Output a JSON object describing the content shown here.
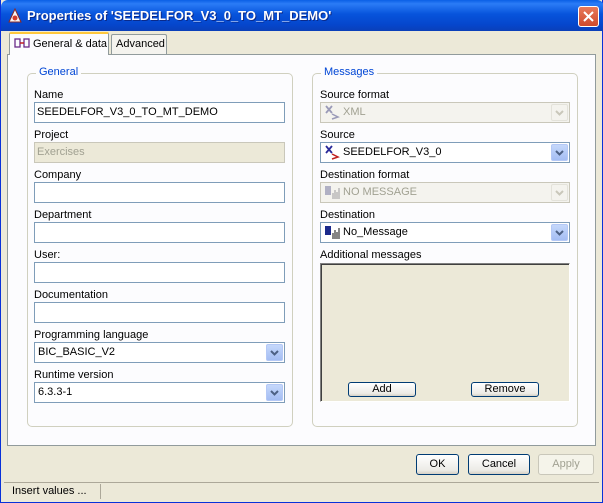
{
  "window": {
    "title": "Properties of 'SEEDELFOR_V3_0_TO_MT_DEMO'"
  },
  "tabs": [
    {
      "label": "General & data",
      "active": true
    },
    {
      "label": "Advanced",
      "active": false
    }
  ],
  "general": {
    "title": "General",
    "name": {
      "label": "Name",
      "value": "SEEDELFOR_V3_0_TO_MT_DEMO"
    },
    "project": {
      "label": "Project",
      "value": "Exercises",
      "disabled": true
    },
    "company": {
      "label": "Company",
      "value": ""
    },
    "department": {
      "label": "Department",
      "value": ""
    },
    "user": {
      "label": "User:",
      "value": ""
    },
    "documentation": {
      "label": "Documentation",
      "value": ""
    },
    "programming_language": {
      "label": "Programming language",
      "value": "BIC_BASIC_V2"
    },
    "runtime_version": {
      "label": "Runtime version",
      "value": "6.3.3-1"
    }
  },
  "messages": {
    "title": "Messages",
    "source_format": {
      "label": "Source format",
      "value": "XML",
      "icon": "xml-format-icon",
      "disabled": true
    },
    "source": {
      "label": "Source",
      "value": "SEEDELFOR_V3_0",
      "icon": "xml-format-icon"
    },
    "destination_format": {
      "label": "Destination format",
      "value": "NO MESSAGE",
      "icon": "data-format-icon",
      "disabled": true
    },
    "destination": {
      "label": "Destination",
      "value": "No_Message",
      "icon": "data-format-icon"
    },
    "additional": {
      "label": "Additional messages",
      "items": []
    },
    "add_label": "Add",
    "remove_label": "Remove"
  },
  "footer": {
    "ok_label": "OK",
    "cancel_label": "Cancel",
    "apply_label": "Apply"
  },
  "status": {
    "text": "Insert values  ..."
  },
  "colors": {
    "title_bar": "#0754dc",
    "group_title": "#0046d5",
    "dialog_bg": "#ece9d8",
    "close_button": "#cf4a2c"
  }
}
